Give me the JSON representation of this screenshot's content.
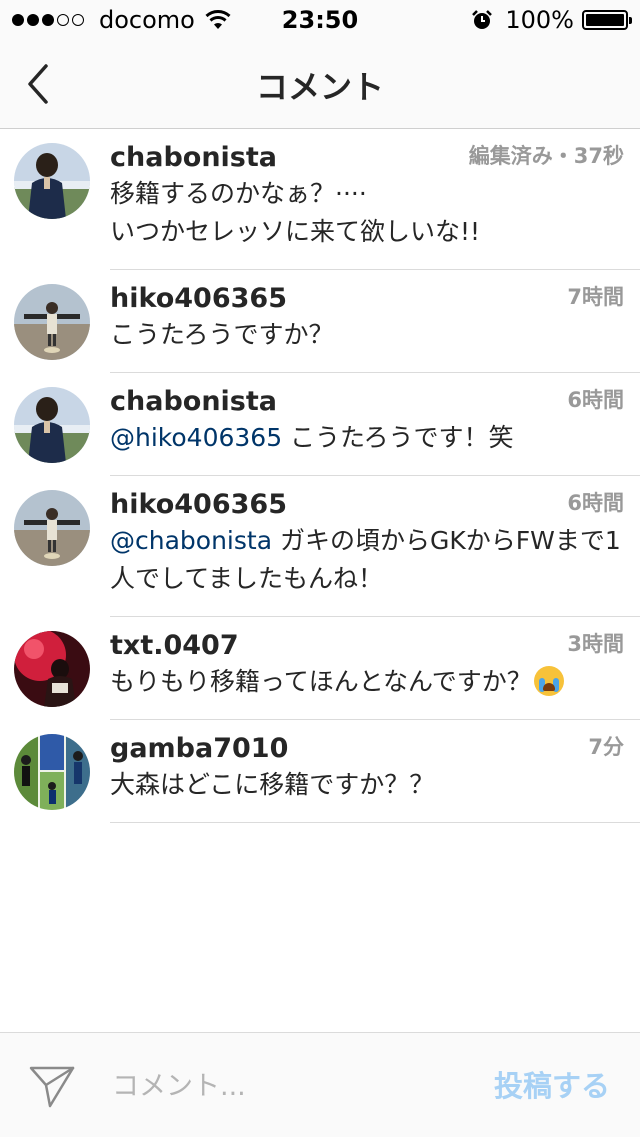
{
  "status_bar": {
    "carrier": "docomo",
    "signal_bars_filled": 3,
    "signal_bars_total": 5,
    "time": "23:50",
    "battery": "100%"
  },
  "nav": {
    "title": "コメント",
    "back_icon": "chevron-left-icon"
  },
  "comments": [
    {
      "username": "chabonista",
      "time": "編集済み・37秒",
      "lines": [
        "移籍するのかなぁ？····",
        "いつかセレッソに来て欲しいな!!"
      ]
    },
    {
      "username": "hiko406365",
      "time": "7時間",
      "text": "こうたろうですか？"
    },
    {
      "username": "chabonista",
      "time": "6時間",
      "mention": "@hiko406365",
      "text": " こうたろうです！笑"
    },
    {
      "username": "hiko406365",
      "time": "6時間",
      "mention": "@chabonista",
      "text": " ガキの頃からGKからFWまで1人でしてましたもんね！"
    },
    {
      "username": "txt.0407",
      "time": "3時間",
      "text": "もりもり移籍ってほんとなんですか？"
    },
    {
      "username": "gamba7010",
      "time": "7分",
      "text": "大森はどこに移籍ですか？？"
    }
  ],
  "input_bar": {
    "placeholder": "コメント...",
    "post_label": "投稿する",
    "send_icon": "paper-plane-icon"
  },
  "colors": {
    "mention": "#003569",
    "timestamp": "#999999",
    "post_disabled": "#a7d1f5"
  }
}
